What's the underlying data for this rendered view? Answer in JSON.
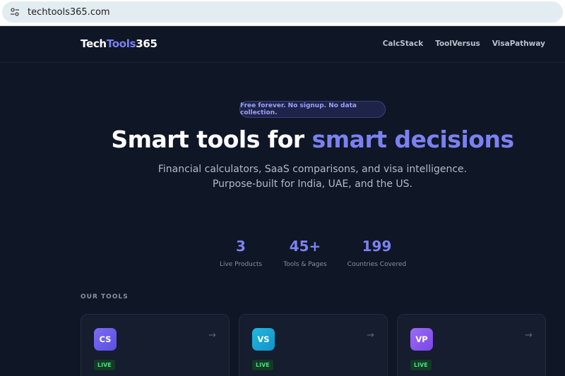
{
  "browser": {
    "url": "techtools365.com",
    "site_info_icon": "tune-icon"
  },
  "header": {
    "logo_part1": "Tech",
    "logo_part2": "Tools",
    "logo_part3": "365",
    "nav": [
      "CalcStack",
      "ToolVersus",
      "VisaPathway"
    ]
  },
  "hero": {
    "badge": "Free forever. No signup. No data collection.",
    "headline_plain": "Smart tools for ",
    "headline_accent": "smart decisions",
    "subtitle_line1": "Financial calculators, SaaS comparisons, and visa intelligence.",
    "subtitle_line2": "Purpose-built for India, UAE, and the US."
  },
  "stats": [
    {
      "value": "3",
      "label": "Live Products"
    },
    {
      "value": "45+",
      "label": "Tools & Pages"
    },
    {
      "value": "199",
      "label": "Countries Covered"
    }
  ],
  "tools": {
    "section_label": "OUR TOOLS",
    "cards": [
      {
        "abbr": "CS",
        "status": "LIVE",
        "arrow": "→",
        "color": "#6d5df0"
      },
      {
        "abbr": "VS",
        "status": "LIVE",
        "arrow": "→",
        "color": "#1aa7d8"
      },
      {
        "abbr": "VP",
        "status": "LIVE",
        "arrow": "→",
        "color": "#8b5cf6"
      }
    ]
  },
  "colors": {
    "background": "#0f1626",
    "accent": "#7b81f0",
    "live": "#4ade80"
  }
}
